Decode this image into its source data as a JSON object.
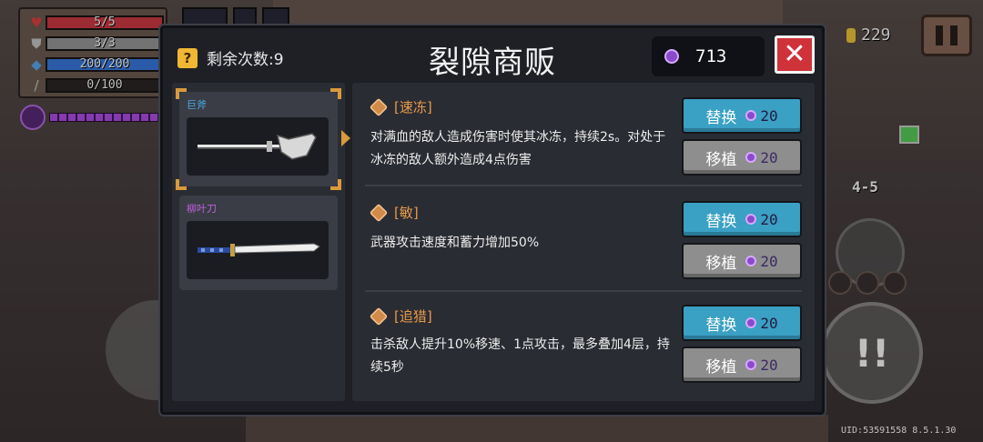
{
  "hud": {
    "hp": "5/5",
    "hp_fraction": 1.0,
    "armor": "3/3",
    "armor_fraction": 1.0,
    "energy": "200/200",
    "energy_fraction": 1.0,
    "exp": "0/100",
    "exp_fraction": 0.0,
    "gold": "229",
    "level": "4-5",
    "uid": "UID:53591558 8.5.1.30",
    "skill_symbol": "!!"
  },
  "shop": {
    "title": "裂隙商贩",
    "remaining_label": "剩余次数:9",
    "question_mark": "?",
    "gems": "713",
    "close_symbol": "✕"
  },
  "weapons": [
    {
      "name": "巨斧",
      "name_color": "#4aa8e8",
      "selected": true
    },
    {
      "name": "柳叶刀",
      "name_color": "#c060e0",
      "selected": false
    }
  ],
  "traits": [
    {
      "name": "[速冻]",
      "description": "对满血的敌人造成伤害时使其冰冻，持续2s。对处于冰冻的敌人额外造成4点伤害",
      "replace_label": "替换",
      "replace_cost": "20",
      "transplant_label": "移植",
      "transplant_cost": "20"
    },
    {
      "name": "[敏]",
      "description": "武器攻击速度和蓄力增加50%",
      "replace_label": "替换",
      "replace_cost": "20",
      "transplant_label": "移植",
      "transplant_cost": "20"
    },
    {
      "name": "[追猎]",
      "description": "击杀敌人提升10%移速、1点攻击，最多叠加4层，持续5秒",
      "replace_label": "替换",
      "replace_cost": "20",
      "transplant_label": "移植",
      "transplant_cost": "20"
    }
  ]
}
